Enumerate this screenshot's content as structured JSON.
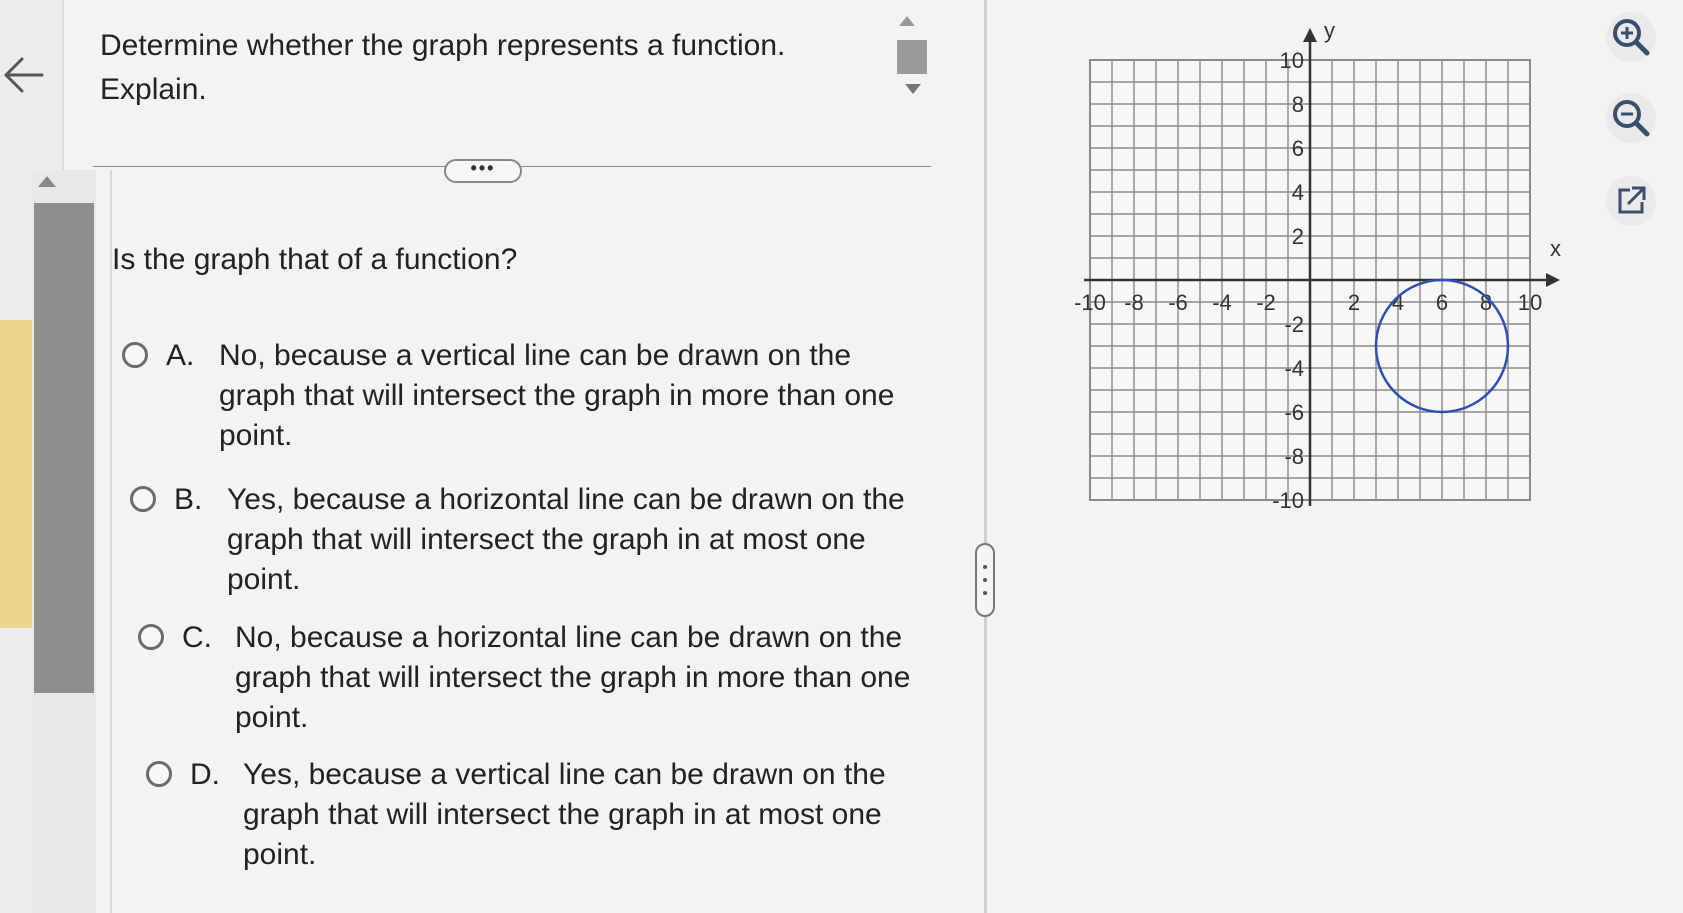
{
  "question": {
    "title": "Determine whether the graph represents a function. Explain.",
    "more_label": "•••",
    "prompt": "Is the graph that of a function?"
  },
  "options": [
    {
      "letter": "A.",
      "text": "No, because a vertical line can be drawn on the graph that will intersect the graph in more than one point."
    },
    {
      "letter": "B.",
      "text": "Yes, because a horizontal line can be drawn on the graph that will intersect the graph in at most one point."
    },
    {
      "letter": "C.",
      "text": "No, because a horizontal line can be drawn on the graph that will intersect the graph in more than one point."
    },
    {
      "letter": "D.",
      "text": "Yes, because a vertical line can be drawn on the graph that will intersect the graph in at most one point."
    }
  ],
  "graph": {
    "x_axis_label": "x",
    "y_axis_label": "y",
    "x_range": [
      -10,
      10
    ],
    "y_range": [
      -10,
      10
    ],
    "grid_step": 1,
    "x_tick_labels": [
      "-10",
      "-8",
      "-6",
      "-4",
      "-2",
      "2",
      "4",
      "6",
      "8",
      "10"
    ],
    "y_tick_labels": [
      "10",
      "8",
      "6",
      "4",
      "2",
      "-2",
      "-4",
      "-6",
      "-8",
      "-10"
    ],
    "curve": {
      "type": "circle",
      "center": [
        6,
        -3
      ],
      "radius": 3,
      "color": "#2f4fb5"
    },
    "grid_color": "#8a8a8a",
    "axis_color": "#333333"
  },
  "toolbar": {
    "icons": [
      "zoom-in-icon",
      "zoom-out-icon",
      "popout-icon"
    ],
    "icon_color": "#3a4f6e"
  }
}
